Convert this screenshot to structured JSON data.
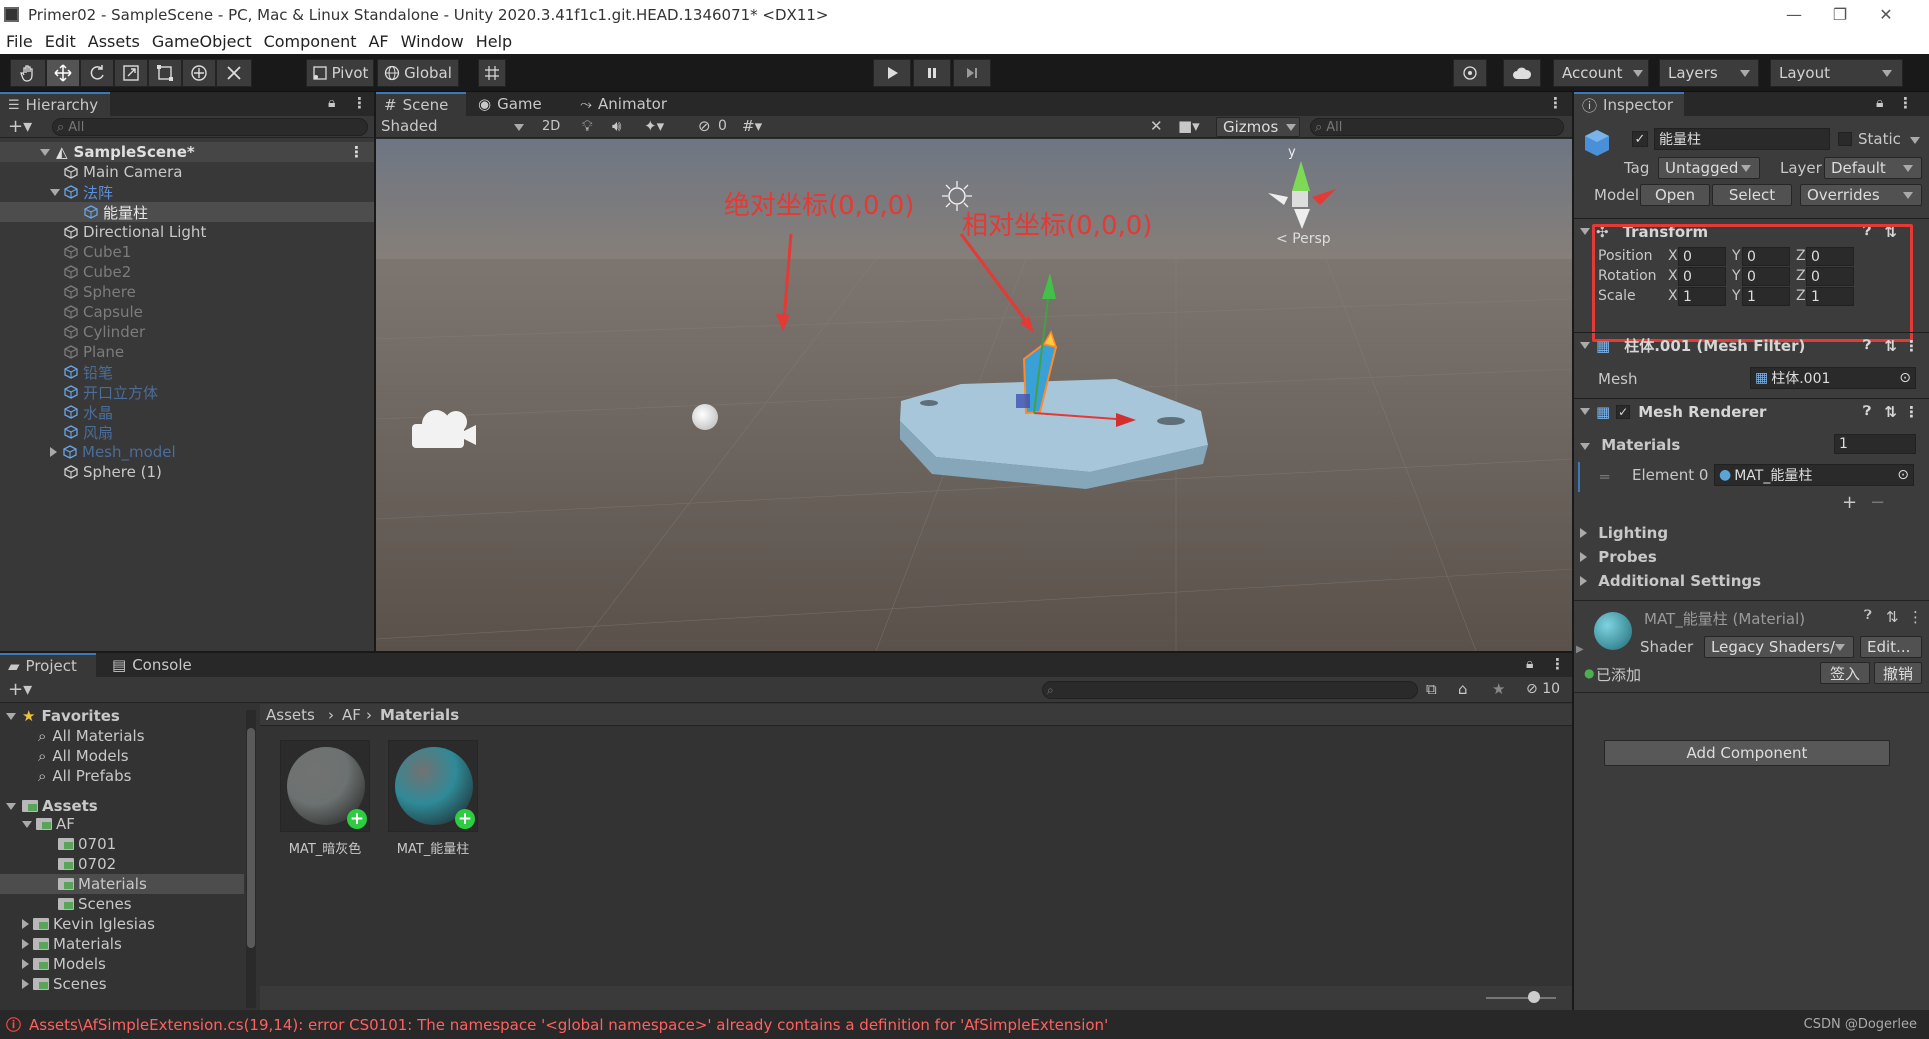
{
  "window": {
    "title": "Primer02 - SampleScene - PC, Mac & Linux Standalone - Unity 2020.3.41f1c1.git.HEAD.1346071* <DX11>",
    "controls": [
      "—",
      "❐",
      "✕"
    ]
  },
  "menu": [
    "File",
    "Edit",
    "Assets",
    "GameObject",
    "Component",
    "AF",
    "Window",
    "Help"
  ],
  "toolbar": {
    "pivot": "Pivot",
    "global": "Global",
    "account": "Account",
    "layers": "Layers",
    "layout": "Layout"
  },
  "hierarchy": {
    "tab": "Hierarchy",
    "search_placeholder": "All",
    "scene": "SampleScene*",
    "items": [
      {
        "label": "Main Camera",
        "style": "normal"
      },
      {
        "label": "法阵",
        "style": "blue"
      },
      {
        "label": "能量柱",
        "style": "selected"
      },
      {
        "label": "Directional Light",
        "style": "normal"
      },
      {
        "label": "Cube1",
        "style": "dis"
      },
      {
        "label": "Cube2",
        "style": "dis"
      },
      {
        "label": "Sphere",
        "style": "dis"
      },
      {
        "label": "Capsule",
        "style": "dis"
      },
      {
        "label": "Cylinder",
        "style": "dis"
      },
      {
        "label": "Plane",
        "style": "dis"
      },
      {
        "label": "铅笔",
        "style": "blue-dim"
      },
      {
        "label": "开口立方体",
        "style": "blue-dim"
      },
      {
        "label": "水晶",
        "style": "blue-dim"
      },
      {
        "label": "风扇",
        "style": "blue-dim"
      },
      {
        "label": "Mesh_model",
        "style": "blue-dim"
      },
      {
        "label": "Sphere (1)",
        "style": "normal"
      }
    ]
  },
  "scene_view": {
    "tabs": [
      "Scene",
      "Game",
      "Animator"
    ],
    "shading": "Shaded",
    "mode_2d": "2D",
    "hidden_count": "0",
    "gizmos": "Gizmos",
    "search_placeholder": "All",
    "persp": "Persp",
    "gizmo_axis_y": "y",
    "annotation_absolute": "绝对坐标(0,0,0)",
    "annotation_relative": "相对坐标(0,0,0)"
  },
  "inspector": {
    "tab": "Inspector",
    "object_name": "能量柱",
    "static_label": "Static",
    "tag_label": "Tag",
    "tag_value": "Untagged",
    "layer_label": "Layer",
    "layer_value": "Default",
    "model_label": "Model",
    "open": "Open",
    "select": "Select",
    "overrides": "Overrides",
    "transform": {
      "title": "Transform",
      "position_label": "Position",
      "rotation_label": "Rotation",
      "scale_label": "Scale",
      "x": "X",
      "y": "Y",
      "z": "Z",
      "position": [
        "0",
        "0",
        "0"
      ],
      "rotation": [
        "0",
        "0",
        "0"
      ],
      "scale": [
        "1",
        "1",
        "1"
      ]
    },
    "mesh_filter": {
      "title": "柱体.001 (Mesh Filter)",
      "mesh_label": "Mesh",
      "mesh_value": "柱体.001"
    },
    "mesh_renderer": {
      "title": "Mesh Renderer",
      "materials_label": "Materials",
      "materials_count": "1",
      "element_label": "Element 0",
      "element_value": "MAT_能量柱",
      "plus": "+",
      "minus": "−"
    },
    "sections": [
      "Lighting",
      "Probes",
      "Additional Settings"
    ],
    "material": {
      "name": "MAT_能量柱 (Material)",
      "shader_label": "Shader",
      "shader_value": "Legacy Shaders/",
      "edit": "Edit...",
      "added": "已添加",
      "sign_in": "签入",
      "undo": "撤销"
    },
    "add_component": "Add Component"
  },
  "project": {
    "tabs": [
      "Project",
      "Console"
    ],
    "favorites_label": "Favorites",
    "favorites": [
      "All Materials",
      "All Models",
      "All Prefabs"
    ],
    "assets_label": "Assets",
    "tree": [
      {
        "label": "AF",
        "level": 1
      },
      {
        "label": "0701",
        "level": 2
      },
      {
        "label": "0702",
        "level": 2
      },
      {
        "label": "Materials",
        "level": 2
      },
      {
        "label": "Scenes",
        "level": 2
      },
      {
        "label": "Kevin Iglesias",
        "level": 1
      },
      {
        "label": "Materials",
        "level": 1
      },
      {
        "label": "Models",
        "level": 1
      },
      {
        "label": "Scenes",
        "level": 1
      }
    ],
    "breadcrumb": [
      "Assets",
      "AF",
      "Materials"
    ],
    "hidden_packages": "10",
    "assets": [
      {
        "name": "MAT_暗灰色",
        "color": "#6c7271"
      },
      {
        "name": "MAT_能量柱",
        "color": "#2f8a98"
      }
    ]
  },
  "status": {
    "error": "Assets\\AfSimpleExtension.cs(19,14): error CS0101: The namespace '<global namespace>' already contains a definition for 'AfSimpleExtension'",
    "watermark": "CSDN @Dogerlee"
  },
  "colors": {
    "annotation_red": "#e53935",
    "selection_blue": "#3a79bb"
  }
}
